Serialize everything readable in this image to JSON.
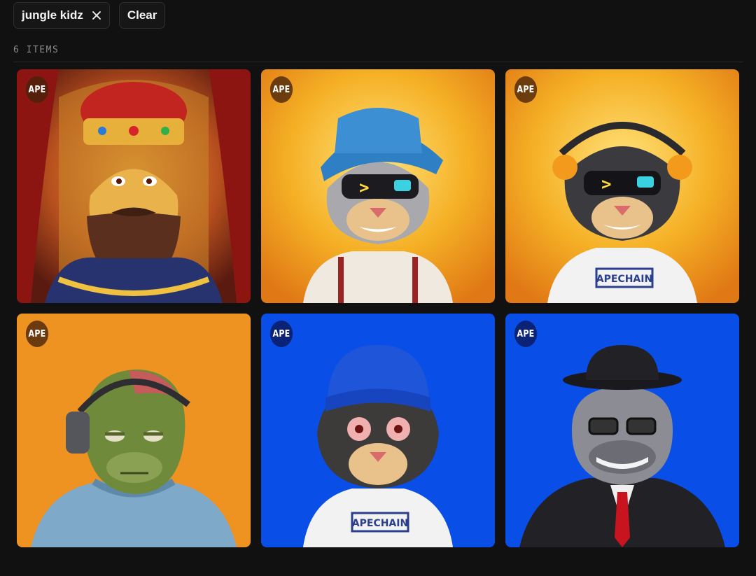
{
  "filters": {
    "active_chip": "jungle kidz",
    "clear_label": "Clear"
  },
  "results": {
    "count_label": "6 ITEMS"
  },
  "colors": {
    "background": "#111112",
    "orange_bg": "#ee9322",
    "blue_bg": "#0a4ee8",
    "throne_red": "#9a1f1a"
  },
  "items": [
    {
      "badge": "APE",
      "subject": "crowned-ape-king"
    },
    {
      "badge": "APE",
      "subject": "cyborg-panther-bucket-hat"
    },
    {
      "badge": "APE",
      "subject": "panther-headphones",
      "shirt_text": "APECHAIN"
    },
    {
      "badge": "APE",
      "subject": "zombie-ape-headphones"
    },
    {
      "badge": "APE",
      "subject": "panther-beanie",
      "shirt_text": "APECHAIN"
    },
    {
      "badge": "APE",
      "subject": "robot-gorilla-bowler"
    }
  ]
}
